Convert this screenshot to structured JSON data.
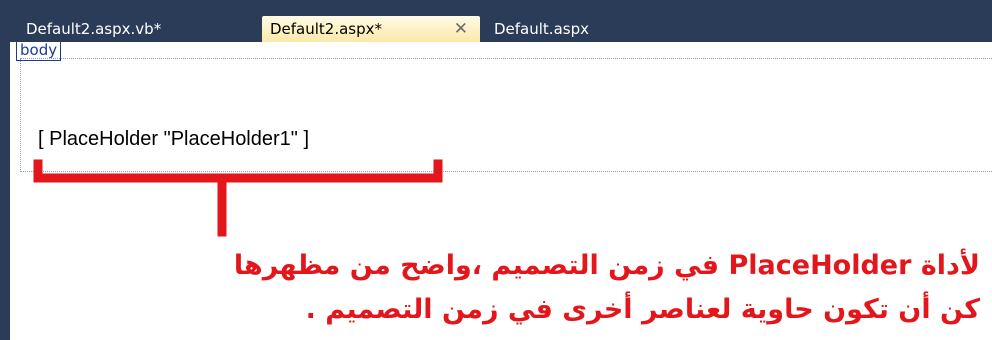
{
  "tabs": [
    {
      "label": "Default2.aspx.vb*",
      "active": false
    },
    {
      "label": "Default2.aspx*",
      "active": true,
      "close": "✕"
    },
    {
      "label": "Default.aspx",
      "active": false
    }
  ],
  "designer": {
    "body_tag": "body",
    "control_text": "[ PlaceHolder \"PlaceHolder1\" ]"
  },
  "annotation": {
    "line1": "لأداة PlaceHolder في زمن التصميم ،واضح من مظهرها",
    "line2": "كن أن تكون حاوية لعناصر أخرى في زمن التصميم .",
    "color": "#e3161b"
  }
}
